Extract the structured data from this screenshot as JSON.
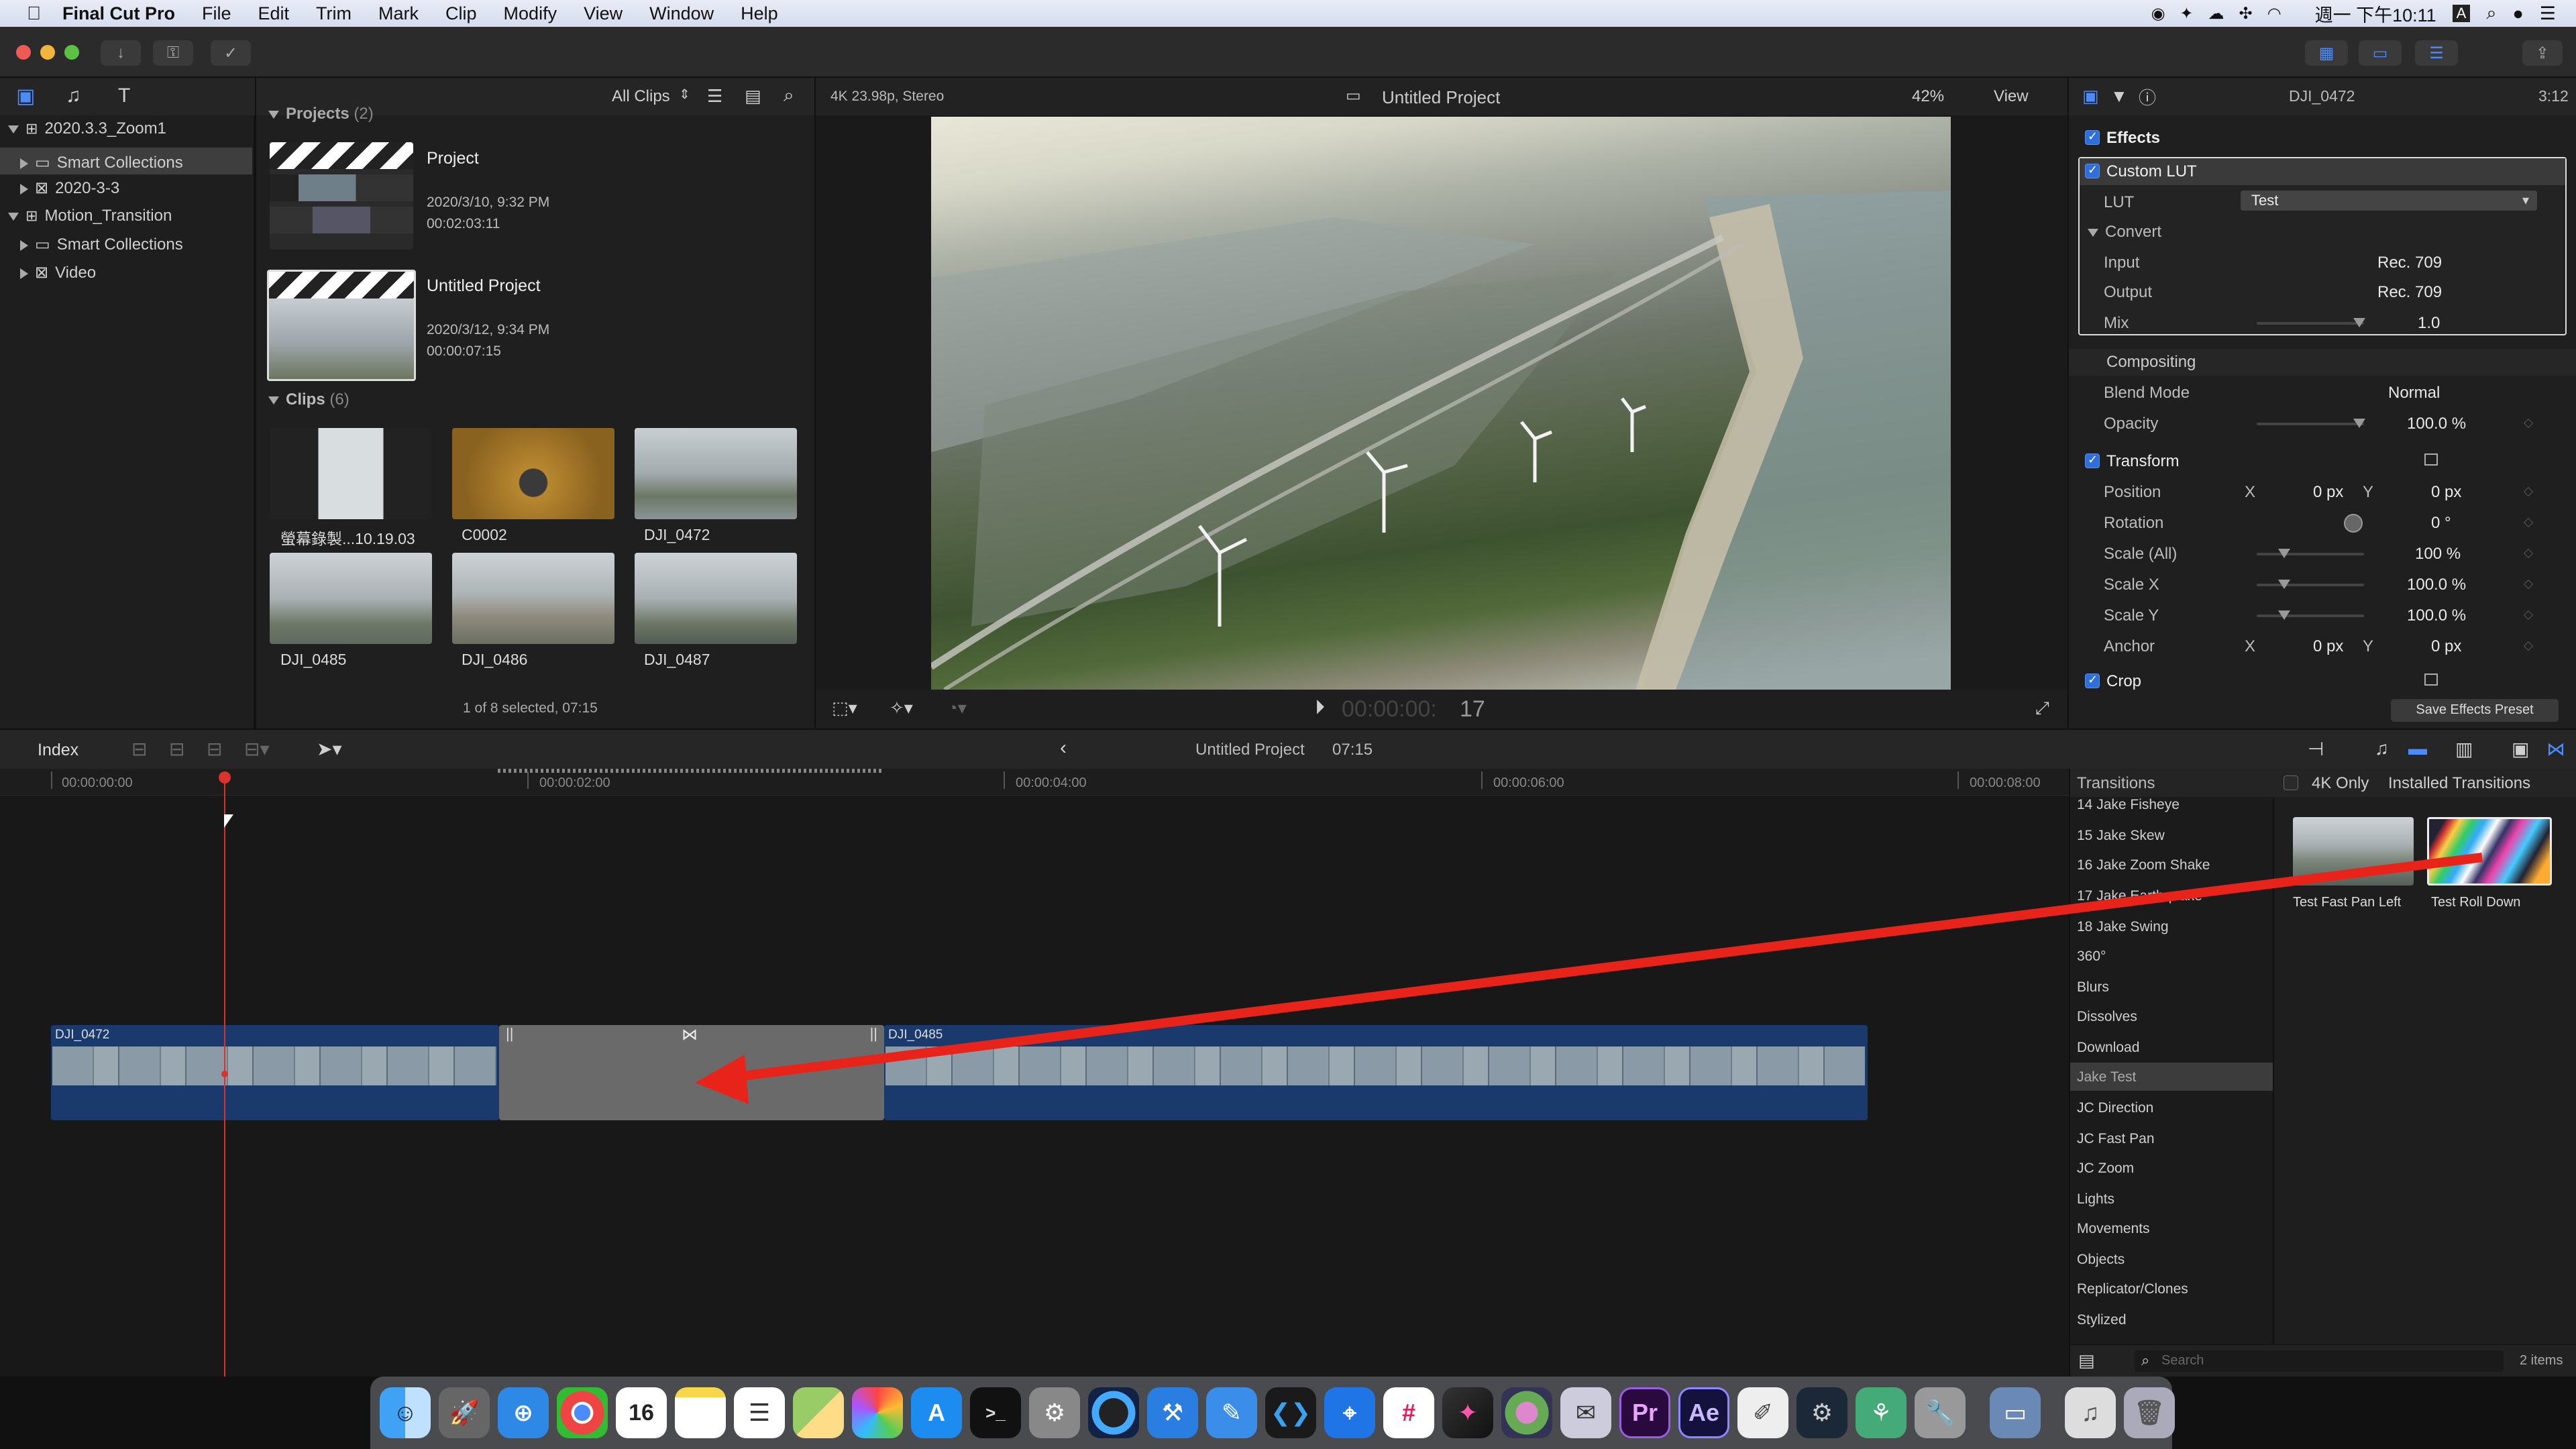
{
  "menubar": {
    "app_name": "Final Cut Pro",
    "items": [
      "File",
      "Edit",
      "Trim",
      "Mark",
      "Clip",
      "Modify",
      "View",
      "Window",
      "Help"
    ],
    "clock": "週一 下午10:11",
    "input_method": "A"
  },
  "browser": {
    "library": "2020.3.3_Zoom1",
    "tree": [
      {
        "label": "Smart Collections",
        "selected": true
      },
      {
        "label": "2020-3-3",
        "selected": false
      }
    ],
    "library2": "Motion_Transition",
    "tree2": [
      {
        "label": "Smart Collections"
      },
      {
        "label": "Video"
      }
    ],
    "filter": "All Clips",
    "projects_header": "Projects",
    "projects_count": "(2)",
    "projects": [
      {
        "name": "Project",
        "date": "2020/3/10, 9:32 PM",
        "duration": "00:02:03:11"
      },
      {
        "name": "Untitled Project",
        "date": "2020/3/12, 9:34 PM",
        "duration": "00:00:07:15"
      }
    ],
    "clips_header": "Clips",
    "clips_count": "(6)",
    "clips": [
      "螢幕錄製...10.19.03",
      "C0002",
      "DJI_0472",
      "DJI_0485",
      "DJI_0486",
      "DJI_0487"
    ],
    "status": "1 of 8 selected, 07:15"
  },
  "viewer": {
    "format": "4K 23.98p, Stereo",
    "title": "Untitled Project",
    "zoom": "42%",
    "view_label": "View",
    "timecode_dim": "00:00:00:",
    "timecode_frame": "17"
  },
  "inspector": {
    "clip_name": "DJI_0472",
    "clip_time": "3:12",
    "effects_label": "Effects",
    "custom_lut": "Custom LUT",
    "lut_label": "LUT",
    "lut_value": "Test",
    "convert_label": "Convert",
    "input_label": "Input",
    "input_value": "Rec. 709",
    "output_label": "Output",
    "output_value": "Rec. 709",
    "mix_label": "Mix",
    "mix_value": "1.0",
    "compositing_label": "Compositing",
    "blend_label": "Blend Mode",
    "blend_value": "Normal",
    "opacity_label": "Opacity",
    "opacity_value": "100.0 %",
    "transform_label": "Transform",
    "position_label": "Position",
    "x_label": "X",
    "y_label": "Y",
    "position_x": "0 px",
    "position_y": "0 px",
    "rotation_label": "Rotation",
    "rotation_value": "0 °",
    "scale_all_label": "Scale (All)",
    "scale_all_value": "100 %",
    "scale_x_label": "Scale X",
    "scale_x_value": "100.0 %",
    "scale_y_label": "Scale Y",
    "scale_y_value": "100.0 %",
    "anchor_label": "Anchor",
    "anchor_x": "0 px",
    "anchor_y": "0 px",
    "crop_label": "Crop",
    "save_preset": "Save Effects Preset"
  },
  "timeline": {
    "index_label": "Index",
    "project": "Untitled Project",
    "duration": "07:15",
    "ruler": [
      "00:00:00:00",
      "00:00:02:00",
      "00:00:04:00",
      "00:00:06:00",
      "00:00:08:00"
    ],
    "clip_left": "DJI_0472",
    "clip_right": "DJI_0485"
  },
  "transitions": {
    "header": "Transitions",
    "four_k_only": "4K Only",
    "installed": "Installed Transitions",
    "categories": [
      "14 Jake Fisheye",
      "15 Jake Skew",
      "16 Jake Zoom Shake",
      "17 Jake Earthquake",
      "18 Jake Swing",
      "360°",
      "Blurs",
      "Dissolves",
      "Download",
      "Jake Test",
      "JC Direction",
      "JC Fast Pan",
      "JC Zoom",
      "Lights",
      "Movements",
      "Objects",
      "Replicator/Clones",
      "Stylized"
    ],
    "selected_category": "Jake Test",
    "items": [
      {
        "name": "Test Fast Pan Left"
      },
      {
        "name": "Test Roll Down"
      }
    ],
    "search_placeholder": "Search",
    "count": "2 items"
  },
  "dock": {
    "calendar_day": "16",
    "premiere": "Pr",
    "after_effects": "Ae"
  },
  "annotation_color": "#e8241a",
  "accent": "#2f6fdc"
}
